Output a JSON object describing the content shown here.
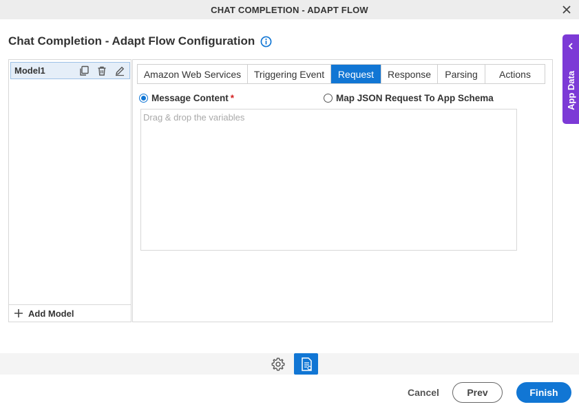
{
  "window": {
    "title": "CHAT COMPLETION - ADAPT FLOW",
    "close_icon": "close-icon"
  },
  "heading": {
    "title": "Chat Completion - Adapt Flow Configuration",
    "info_icon": "info-icon"
  },
  "app_data_panel": {
    "label": "App Data",
    "icon": "chevron-left-icon",
    "color": "#7c3ad6"
  },
  "models": {
    "items": [
      {
        "name": "Model1",
        "selected": true,
        "actions": [
          "copy-icon",
          "trash-icon",
          "pencil-icon"
        ]
      }
    ],
    "add_label": "Add Model"
  },
  "tabs": [
    {
      "label": "Amazon Web Services",
      "active": false
    },
    {
      "label": "Triggering Event",
      "active": false
    },
    {
      "label": "Request",
      "active": true
    },
    {
      "label": "Response",
      "active": false
    },
    {
      "label": "Parsing",
      "active": false
    },
    {
      "label": "Actions",
      "active": false
    }
  ],
  "request": {
    "options": [
      {
        "label": "Message Content",
        "checked": true,
        "required": true
      },
      {
        "label": "Map JSON Request To App Schema",
        "checked": false,
        "required": false
      }
    ],
    "required_marker": "*",
    "dropzone_placeholder": "Drag & drop the variables"
  },
  "toolbar": {
    "settings_icon": "gear-icon",
    "document_icon": "document-settings-icon"
  },
  "footer": {
    "cancel_label": "Cancel",
    "prev_label": "Prev",
    "finish_label": "Finish"
  },
  "colors": {
    "accent": "#1176d4",
    "purple": "#7c3ad6",
    "required": "#d42020"
  }
}
